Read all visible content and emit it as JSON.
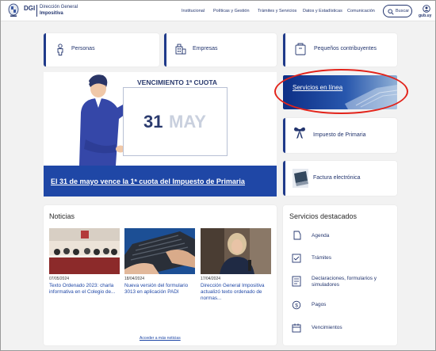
{
  "header": {
    "logo_abbr": "DGI",
    "logo_line1": "Dirección General",
    "logo_line2": "Impositiva",
    "nav": [
      "Institucional",
      "Políticas y Gestión",
      "Trámites y Servicios",
      "Datos y Estadísticas",
      "Comunicación"
    ],
    "search_label": "Buscar",
    "gub_label": "gub.uy"
  },
  "quick_links": {
    "personas": "Personas",
    "empresas": "Empresas",
    "pequenos": "Pequeños contribuyentes"
  },
  "banner": {
    "title": "VENCIMIENTO 1ª CUOTA",
    "day": "31",
    "month": "MAY",
    "link": "El 31 de mayo vence la 1ª cuota del Impuesto de Primaria"
  },
  "side_links": {
    "servicios_en_linea": "Servicios en línea",
    "impuesto_primaria": "Impuesto de Primaria",
    "factura": "Factura electrónica"
  },
  "noticias": {
    "title": "Noticias",
    "items": [
      {
        "date": "07/05/2024",
        "text": "Texto Ordenado 2023: charla informativa en el Colegio de..."
      },
      {
        "date": "18/04/2024",
        "text": "Nueva versión del formulario 3013 en aplicación PADI"
      },
      {
        "date": "17/04/2024",
        "text": "Dirección General Impositiva actualizó texto ordenado de normas..."
      }
    ],
    "more": "Acceder a más noticias"
  },
  "destacados": {
    "title": "Servicios destacados",
    "items": [
      "Agenda",
      "Trámites",
      "Declaraciones, formularios y simuladores",
      "Pagos",
      "Vencimientos"
    ]
  },
  "colors": {
    "brand": "#23356e",
    "accent": "#1f47a6",
    "highlight": "#e2231a"
  }
}
